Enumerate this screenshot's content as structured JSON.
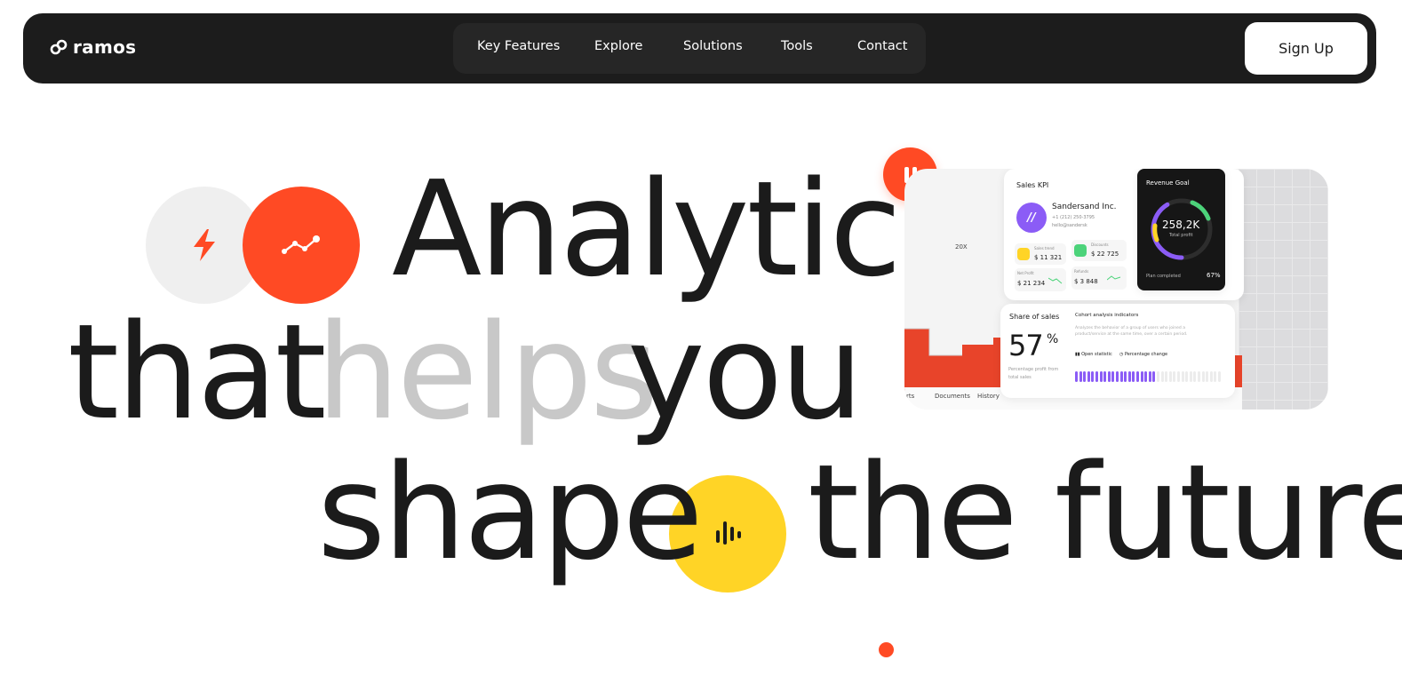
{
  "nav": {
    "logo_text": "ramos",
    "links": [
      "Key Features",
      "Explore",
      "Solutions",
      "Tools",
      "Contact"
    ],
    "signup_label": "Sign Up"
  },
  "hero": {
    "line1": "Analytics",
    "line2_a": "that",
    "line2_b": "helps",
    "line2_c": "you",
    "line3_a": "shape",
    "line3_b": "the future"
  },
  "dashboard": {
    "sales_kpi_title": "Sales KPI",
    "company_name": "Sandersand Inc.",
    "company_phone": "+1 (212) 250-3795",
    "company_email": "hello@sandersk",
    "stats": [
      {
        "label": "Sales trend",
        "value": "$ 11 321"
      },
      {
        "label": "Discounts",
        "value": "$ 22 725"
      },
      {
        "label": "Net Profit",
        "value": "$ 21 234"
      },
      {
        "label": "Refunds",
        "value": "$ 3 848"
      }
    ],
    "revenue_goal_title": "Revenue Goal",
    "revenue_value": "258,2K",
    "revenue_sub": "Total profit",
    "plan_label": "Plan completed",
    "plan_value": "67%",
    "plan_fraction": 0.67,
    "share_title": "Share of sales",
    "share_value": "57",
    "share_unit": "%",
    "share_caption": "Percentage profit from total sales",
    "cohort_title": "Cohort analysis indicators",
    "cohort_text": "Analyzes the behavior of a group of users who joined a product/service at the same time, over a certain period.",
    "open_statistic": "Open statistic",
    "percentage_change": "Percentage change",
    "chart_multiplier": "20X",
    "bottom_tabs": [
      "rts",
      "Documents",
      "History"
    ],
    "cohort_bar_fill": 0.55
  },
  "colors": {
    "accent_red": "#ff4a24",
    "accent_yellow": "#ffd426",
    "accent_purple": "#8b5cf6",
    "nav_bg": "#1c1c1c"
  },
  "icons": {
    "logo": "link-icon",
    "gray_circle": "lightning-icon",
    "red_circle": "trend-line-icon",
    "pause": "pause-icon",
    "yellow_circle": "audio-bars-icon"
  }
}
